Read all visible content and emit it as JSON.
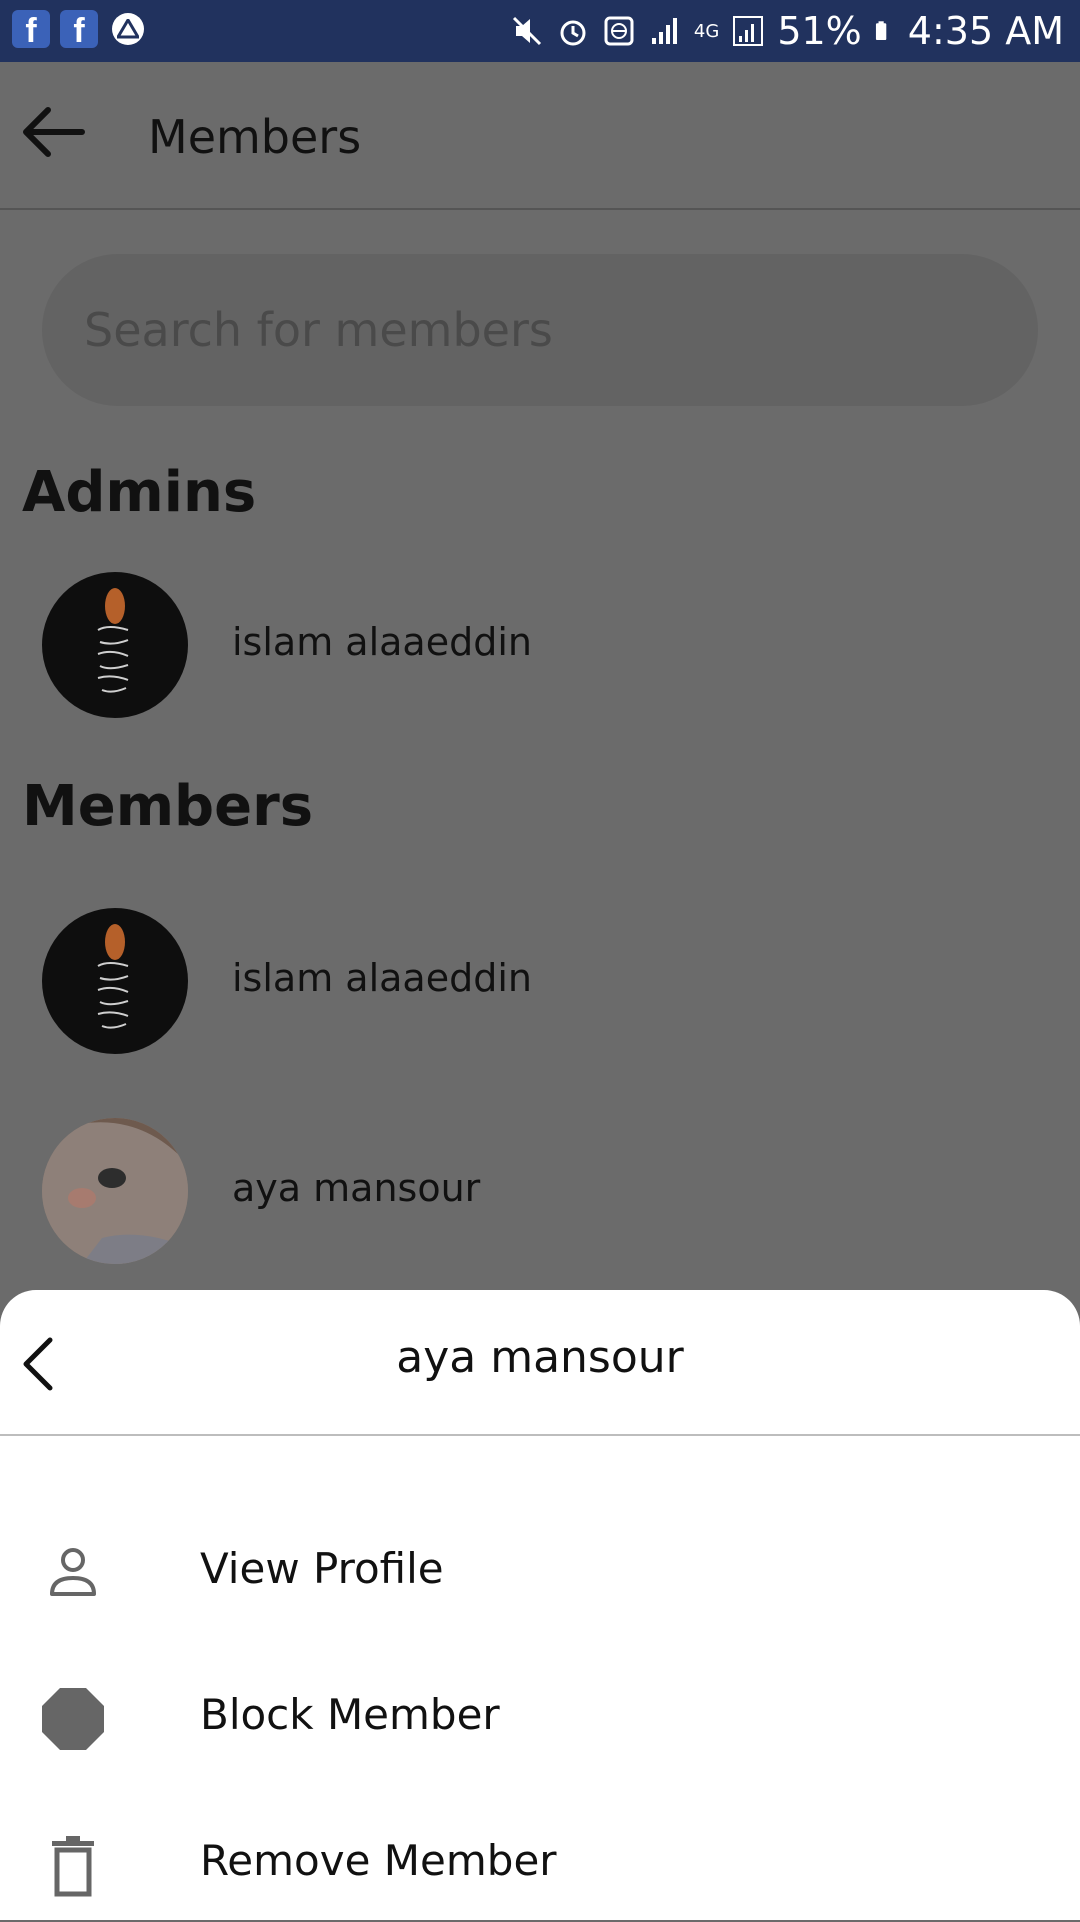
{
  "status_bar": {
    "battery_percent": "51%",
    "time": "4:35 AM",
    "network": "4G"
  },
  "header": {
    "title": "Members"
  },
  "search": {
    "placeholder": "Search for members"
  },
  "sections": {
    "admins_heading": "Admins",
    "members_heading": "Members"
  },
  "admins": [
    {
      "name": "islam alaaeddin"
    }
  ],
  "members": [
    {
      "name": "islam alaaeddin"
    },
    {
      "name": "aya mansour"
    }
  ],
  "sheet": {
    "title": "aya mansour",
    "actions": [
      {
        "label": "View Profile",
        "icon": "person-icon"
      },
      {
        "label": "Block Member",
        "icon": "block-icon"
      },
      {
        "label": "Remove Member",
        "icon": "trash-icon"
      }
    ]
  },
  "colors": {
    "status_bar": "#21325e",
    "scrim": "#6b6b6b",
    "sheet": "#ffffff"
  }
}
